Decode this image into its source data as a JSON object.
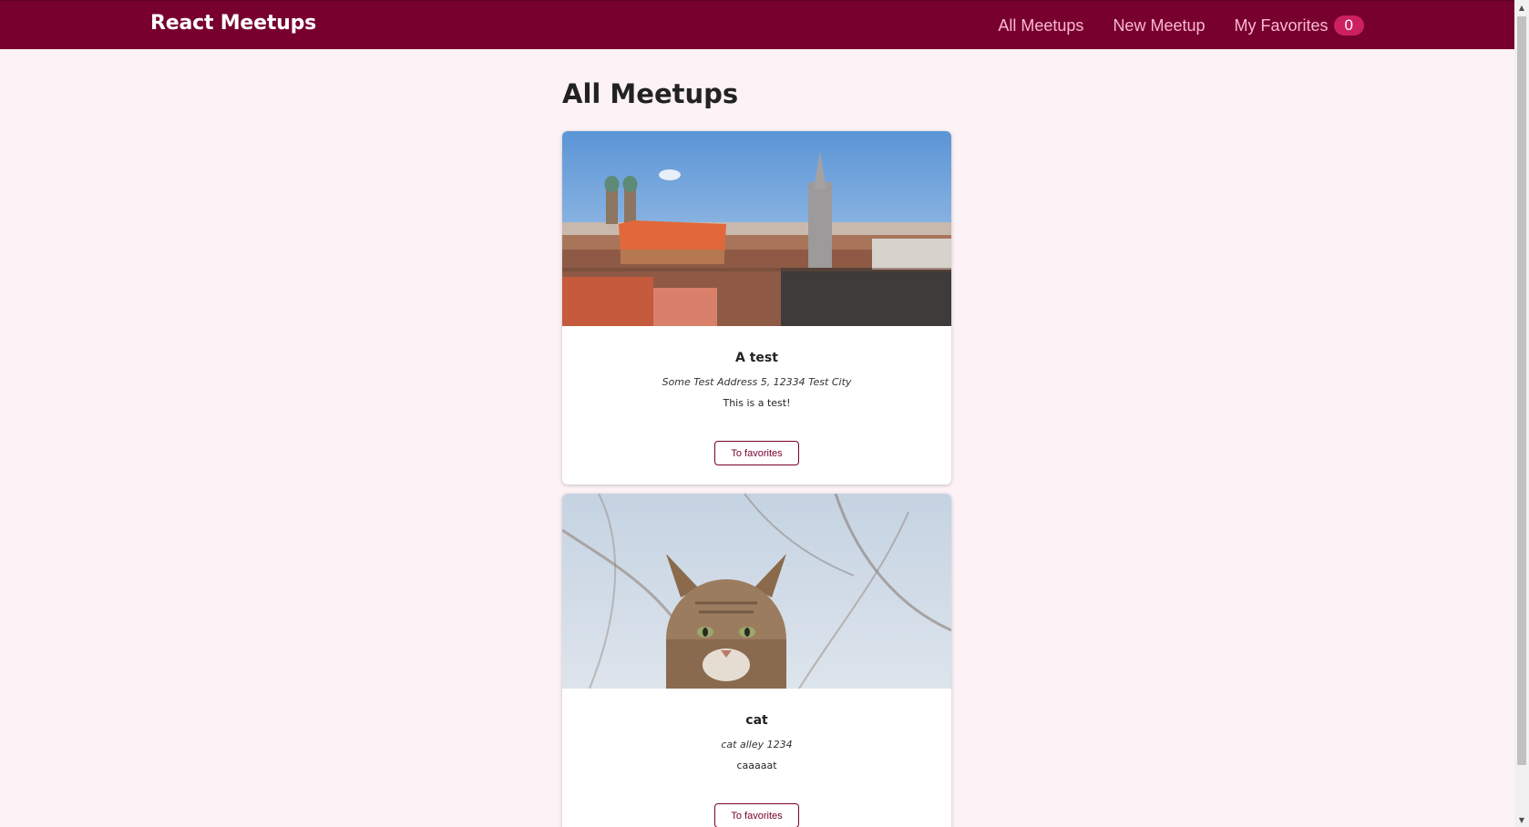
{
  "header": {
    "logo": "React Meetups",
    "nav": {
      "all_meetups": "All Meetups",
      "new_meetup": "New Meetup",
      "my_favorites": "My Favorites",
      "favorites_count": "0"
    }
  },
  "main": {
    "title": "All Meetups",
    "meetups": [
      {
        "title": "A test",
        "address": "Some Test Address 5, 12334 Test City",
        "description": "This is a test!",
        "button_label": "To favorites",
        "image": "munich-cityscape-photo"
      },
      {
        "title": "cat",
        "address": "cat alley 1234",
        "description": "caaaaat",
        "button_label": "To favorites",
        "image": "tabby-cat-photo"
      }
    ]
  },
  "colors": {
    "header_bg": "#77002e",
    "page_bg": "#fdf2f6",
    "nav_link": "#fcb8d2",
    "badge_bg": "#cc2062",
    "accent": "#77002e"
  },
  "scrollbar": {
    "up_icon": "triangle-up-icon",
    "down_icon": "triangle-down-icon"
  }
}
